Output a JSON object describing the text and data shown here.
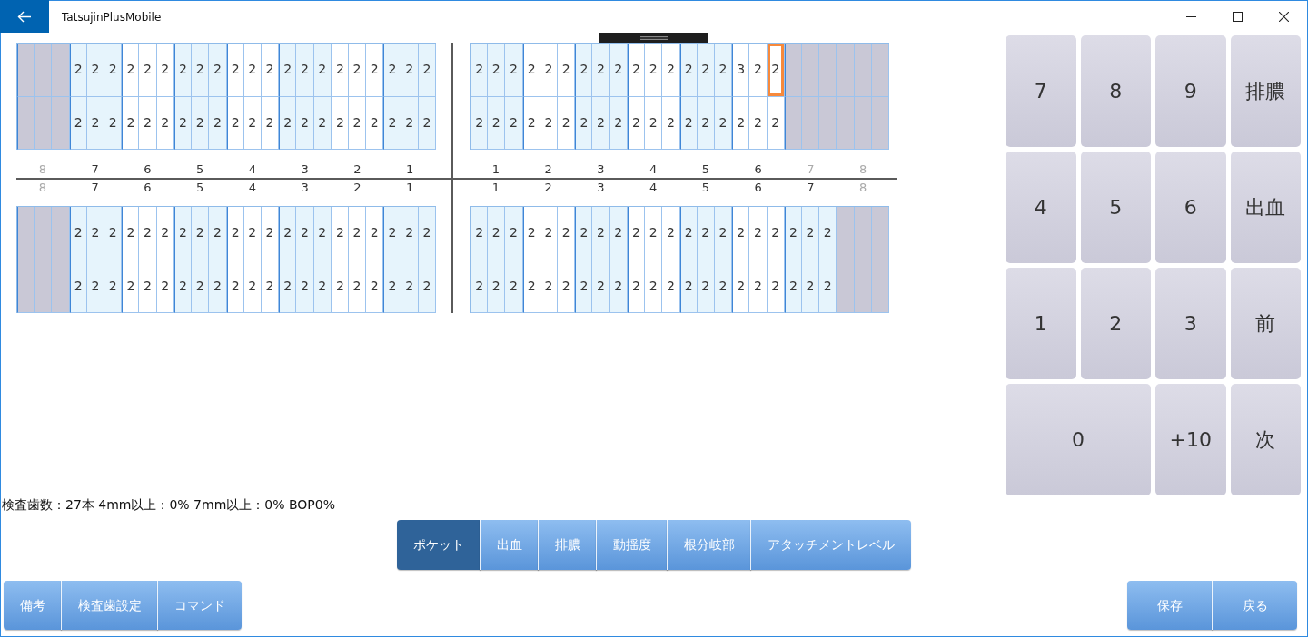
{
  "window": {
    "title": "TatsujinPlusMobile"
  },
  "chart": {
    "quadrants": [
      {
        "teeth": [
          {
            "number": "8",
            "missing": true
          },
          {
            "number": "7",
            "missing": false,
            "sites": [
              [
                {
                  "value": "2",
                  "selected": false
                },
                {
                  "value": "2",
                  "selected": false
                },
                {
                  "value": "2",
                  "selected": false
                }
              ],
              [
                {
                  "value": "2",
                  "selected": false
                },
                {
                  "value": "2",
                  "selected": false
                },
                {
                  "value": "2",
                  "selected": false
                }
              ]
            ]
          },
          {
            "number": "6",
            "missing": false,
            "sites": [
              [
                {
                  "value": "2",
                  "selected": false
                },
                {
                  "value": "2",
                  "selected": false
                },
                {
                  "value": "2",
                  "selected": false
                }
              ],
              [
                {
                  "value": "2",
                  "selected": false
                },
                {
                  "value": "2",
                  "selected": false
                },
                {
                  "value": "2",
                  "selected": false
                }
              ]
            ]
          },
          {
            "number": "5",
            "missing": false,
            "sites": [
              [
                {
                  "value": "2",
                  "selected": false
                },
                {
                  "value": "2",
                  "selected": false
                },
                {
                  "value": "2",
                  "selected": false
                }
              ],
              [
                {
                  "value": "2",
                  "selected": false
                },
                {
                  "value": "2",
                  "selected": false
                },
                {
                  "value": "2",
                  "selected": false
                }
              ]
            ]
          },
          {
            "number": "4",
            "missing": false,
            "sites": [
              [
                {
                  "value": "2",
                  "selected": false
                },
                {
                  "value": "2",
                  "selected": false
                },
                {
                  "value": "2",
                  "selected": false
                }
              ],
              [
                {
                  "value": "2",
                  "selected": false
                },
                {
                  "value": "2",
                  "selected": false
                },
                {
                  "value": "2",
                  "selected": false
                }
              ]
            ]
          },
          {
            "number": "3",
            "missing": false,
            "sites": [
              [
                {
                  "value": "2",
                  "selected": false
                },
                {
                  "value": "2",
                  "selected": false
                },
                {
                  "value": "2",
                  "selected": false
                }
              ],
              [
                {
                  "value": "2",
                  "selected": false
                },
                {
                  "value": "2",
                  "selected": false
                },
                {
                  "value": "2",
                  "selected": false
                }
              ]
            ]
          },
          {
            "number": "2",
            "missing": false,
            "sites": [
              [
                {
                  "value": "2",
                  "selected": false
                },
                {
                  "value": "2",
                  "selected": false
                },
                {
                  "value": "2",
                  "selected": false
                }
              ],
              [
                {
                  "value": "2",
                  "selected": false
                },
                {
                  "value": "2",
                  "selected": false
                },
                {
                  "value": "2",
                  "selected": false
                }
              ]
            ]
          },
          {
            "number": "1",
            "missing": false,
            "sites": [
              [
                {
                  "value": "2",
                  "selected": false
                },
                {
                  "value": "2",
                  "selected": false
                },
                {
                  "value": "2",
                  "selected": false
                }
              ],
              [
                {
                  "value": "2",
                  "selected": false
                },
                {
                  "value": "2",
                  "selected": false
                },
                {
                  "value": "2",
                  "selected": false
                }
              ]
            ]
          }
        ]
      },
      {
        "teeth": [
          {
            "number": "1",
            "missing": false,
            "sites": [
              [
                {
                  "value": "2",
                  "selected": false
                },
                {
                  "value": "2",
                  "selected": false
                },
                {
                  "value": "2",
                  "selected": false
                }
              ],
              [
                {
                  "value": "2",
                  "selected": false
                },
                {
                  "value": "2",
                  "selected": false
                },
                {
                  "value": "2",
                  "selected": false
                }
              ]
            ]
          },
          {
            "number": "2",
            "missing": false,
            "sites": [
              [
                {
                  "value": "2",
                  "selected": false
                },
                {
                  "value": "2",
                  "selected": false
                },
                {
                  "value": "2",
                  "selected": false
                }
              ],
              [
                {
                  "value": "2",
                  "selected": false
                },
                {
                  "value": "2",
                  "selected": false
                },
                {
                  "value": "2",
                  "selected": false
                }
              ]
            ]
          },
          {
            "number": "3",
            "missing": false,
            "sites": [
              [
                {
                  "value": "2",
                  "selected": false
                },
                {
                  "value": "2",
                  "selected": false
                },
                {
                  "value": "2",
                  "selected": false
                }
              ],
              [
                {
                  "value": "2",
                  "selected": false
                },
                {
                  "value": "2",
                  "selected": false
                },
                {
                  "value": "2",
                  "selected": false
                }
              ]
            ]
          },
          {
            "number": "4",
            "missing": false,
            "sites": [
              [
                {
                  "value": "2",
                  "selected": false
                },
                {
                  "value": "2",
                  "selected": false
                },
                {
                  "value": "2",
                  "selected": false
                }
              ],
              [
                {
                  "value": "2",
                  "selected": false
                },
                {
                  "value": "2",
                  "selected": false
                },
                {
                  "value": "2",
                  "selected": false
                }
              ]
            ]
          },
          {
            "number": "5",
            "missing": false,
            "sites": [
              [
                {
                  "value": "2",
                  "selected": false
                },
                {
                  "value": "2",
                  "selected": false
                },
                {
                  "value": "2",
                  "selected": false
                }
              ],
              [
                {
                  "value": "2",
                  "selected": false
                },
                {
                  "value": "2",
                  "selected": false
                },
                {
                  "value": "2",
                  "selected": false
                }
              ]
            ]
          },
          {
            "number": "6",
            "missing": false,
            "sites": [
              [
                {
                  "value": "3",
                  "selected": false
                },
                {
                  "value": "2",
                  "selected": false
                },
                {
                  "value": "2",
                  "selected": true
                }
              ],
              [
                {
                  "value": "2",
                  "selected": false
                },
                {
                  "value": "2",
                  "selected": false
                },
                {
                  "value": "2",
                  "selected": false
                }
              ]
            ]
          },
          {
            "number": "7",
            "missing": true
          },
          {
            "number": "8",
            "missing": true
          }
        ]
      },
      {
        "teeth": [
          {
            "number": "8",
            "missing": true
          },
          {
            "number": "7",
            "missing": false,
            "sites": [
              [
                {
                  "value": "2",
                  "selected": false
                },
                {
                  "value": "2",
                  "selected": false
                },
                {
                  "value": "2",
                  "selected": false
                }
              ],
              [
                {
                  "value": "2",
                  "selected": false
                },
                {
                  "value": "2",
                  "selected": false
                },
                {
                  "value": "2",
                  "selected": false
                }
              ]
            ]
          },
          {
            "number": "6",
            "missing": false,
            "sites": [
              [
                {
                  "value": "2",
                  "selected": false
                },
                {
                  "value": "2",
                  "selected": false
                },
                {
                  "value": "2",
                  "selected": false
                }
              ],
              [
                {
                  "value": "2",
                  "selected": false
                },
                {
                  "value": "2",
                  "selected": false
                },
                {
                  "value": "2",
                  "selected": false
                }
              ]
            ]
          },
          {
            "number": "5",
            "missing": false,
            "sites": [
              [
                {
                  "value": "2",
                  "selected": false
                },
                {
                  "value": "2",
                  "selected": false
                },
                {
                  "value": "2",
                  "selected": false
                }
              ],
              [
                {
                  "value": "2",
                  "selected": false
                },
                {
                  "value": "2",
                  "selected": false
                },
                {
                  "value": "2",
                  "selected": false
                }
              ]
            ]
          },
          {
            "number": "4",
            "missing": false,
            "sites": [
              [
                {
                  "value": "2",
                  "selected": false
                },
                {
                  "value": "2",
                  "selected": false
                },
                {
                  "value": "2",
                  "selected": false
                }
              ],
              [
                {
                  "value": "2",
                  "selected": false
                },
                {
                  "value": "2",
                  "selected": false
                },
                {
                  "value": "2",
                  "selected": false
                }
              ]
            ]
          },
          {
            "number": "3",
            "missing": false,
            "sites": [
              [
                {
                  "value": "2",
                  "selected": false
                },
                {
                  "value": "2",
                  "selected": false
                },
                {
                  "value": "2",
                  "selected": false
                }
              ],
              [
                {
                  "value": "2",
                  "selected": false
                },
                {
                  "value": "2",
                  "selected": false
                },
                {
                  "value": "2",
                  "selected": false
                }
              ]
            ]
          },
          {
            "number": "2",
            "missing": false,
            "sites": [
              [
                {
                  "value": "2",
                  "selected": false
                },
                {
                  "value": "2",
                  "selected": false
                },
                {
                  "value": "2",
                  "selected": false
                }
              ],
              [
                {
                  "value": "2",
                  "selected": false
                },
                {
                  "value": "2",
                  "selected": false
                },
                {
                  "value": "2",
                  "selected": false
                }
              ]
            ]
          },
          {
            "number": "1",
            "missing": false,
            "sites": [
              [
                {
                  "value": "2",
                  "selected": false
                },
                {
                  "value": "2",
                  "selected": false
                },
                {
                  "value": "2",
                  "selected": false
                }
              ],
              [
                {
                  "value": "2",
                  "selected": false
                },
                {
                  "value": "2",
                  "selected": false
                },
                {
                  "value": "2",
                  "selected": false
                }
              ]
            ]
          }
        ]
      },
      {
        "teeth": [
          {
            "number": "1",
            "missing": false,
            "sites": [
              [
                {
                  "value": "2",
                  "selected": false
                },
                {
                  "value": "2",
                  "selected": false
                },
                {
                  "value": "2",
                  "selected": false
                }
              ],
              [
                {
                  "value": "2",
                  "selected": false
                },
                {
                  "value": "2",
                  "selected": false
                },
                {
                  "value": "2",
                  "selected": false
                }
              ]
            ]
          },
          {
            "number": "2",
            "missing": false,
            "sites": [
              [
                {
                  "value": "2",
                  "selected": false
                },
                {
                  "value": "2",
                  "selected": false
                },
                {
                  "value": "2",
                  "selected": false
                }
              ],
              [
                {
                  "value": "2",
                  "selected": false
                },
                {
                  "value": "2",
                  "selected": false
                },
                {
                  "value": "2",
                  "selected": false
                }
              ]
            ]
          },
          {
            "number": "3",
            "missing": false,
            "sites": [
              [
                {
                  "value": "2",
                  "selected": false
                },
                {
                  "value": "2",
                  "selected": false
                },
                {
                  "value": "2",
                  "selected": false
                }
              ],
              [
                {
                  "value": "2",
                  "selected": false
                },
                {
                  "value": "2",
                  "selected": false
                },
                {
                  "value": "2",
                  "selected": false
                }
              ]
            ]
          },
          {
            "number": "4",
            "missing": false,
            "sites": [
              [
                {
                  "value": "2",
                  "selected": false
                },
                {
                  "value": "2",
                  "selected": false
                },
                {
                  "value": "2",
                  "selected": false
                }
              ],
              [
                {
                  "value": "2",
                  "selected": false
                },
                {
                  "value": "2",
                  "selected": false
                },
                {
                  "value": "2",
                  "selected": false
                }
              ]
            ]
          },
          {
            "number": "5",
            "missing": false,
            "sites": [
              [
                {
                  "value": "2",
                  "selected": false
                },
                {
                  "value": "2",
                  "selected": false
                },
                {
                  "value": "2",
                  "selected": false
                }
              ],
              [
                {
                  "value": "2",
                  "selected": false
                },
                {
                  "value": "2",
                  "selected": false
                },
                {
                  "value": "2",
                  "selected": false
                }
              ]
            ]
          },
          {
            "number": "6",
            "missing": false,
            "sites": [
              [
                {
                  "value": "2",
                  "selected": false
                },
                {
                  "value": "2",
                  "selected": false
                },
                {
                  "value": "2",
                  "selected": false
                }
              ],
              [
                {
                  "value": "2",
                  "selected": false
                },
                {
                  "value": "2",
                  "selected": false
                },
                {
                  "value": "2",
                  "selected": false
                }
              ]
            ]
          },
          {
            "number": "7",
            "missing": false,
            "sites": [
              [
                {
                  "value": "2",
                  "selected": false
                },
                {
                  "value": "2",
                  "selected": false
                },
                {
                  "value": "2",
                  "selected": false
                }
              ],
              [
                {
                  "value": "2",
                  "selected": false
                },
                {
                  "value": "2",
                  "selected": false
                },
                {
                  "value": "2",
                  "selected": false
                }
              ]
            ]
          },
          {
            "number": "8",
            "missing": true
          }
        ]
      }
    ]
  },
  "keypad": {
    "keys": [
      {
        "label": "7",
        "wide": false
      },
      {
        "label": "8",
        "wide": false
      },
      {
        "label": "9",
        "wide": false
      },
      {
        "label": "排膿",
        "wide": false
      },
      {
        "label": "4",
        "wide": false
      },
      {
        "label": "5",
        "wide": false
      },
      {
        "label": "6",
        "wide": false
      },
      {
        "label": "出血",
        "wide": false
      },
      {
        "label": "1",
        "wide": false
      },
      {
        "label": "2",
        "wide": false
      },
      {
        "label": "3",
        "wide": false
      },
      {
        "label": "前",
        "wide": false
      },
      {
        "label": "0",
        "wide": true
      },
      {
        "label": "+10",
        "wide": false
      },
      {
        "label": "次",
        "wide": false
      }
    ]
  },
  "summary": "検査歯数：27本 4mm以上：0% 7mm以上：0% BOP0%",
  "mode_tabs": [
    {
      "label": "ポケット",
      "selected": true
    },
    {
      "label": "出血",
      "selected": false
    },
    {
      "label": "排膿",
      "selected": false
    },
    {
      "label": "動揺度",
      "selected": false
    },
    {
      "label": "根分岐部",
      "selected": false
    },
    {
      "label": "アタッチメントレベル",
      "selected": false
    }
  ],
  "left_buttons": [
    "備考",
    "検査歯設定",
    "コマンド"
  ],
  "right_buttons": [
    "保存",
    "戻る"
  ]
}
